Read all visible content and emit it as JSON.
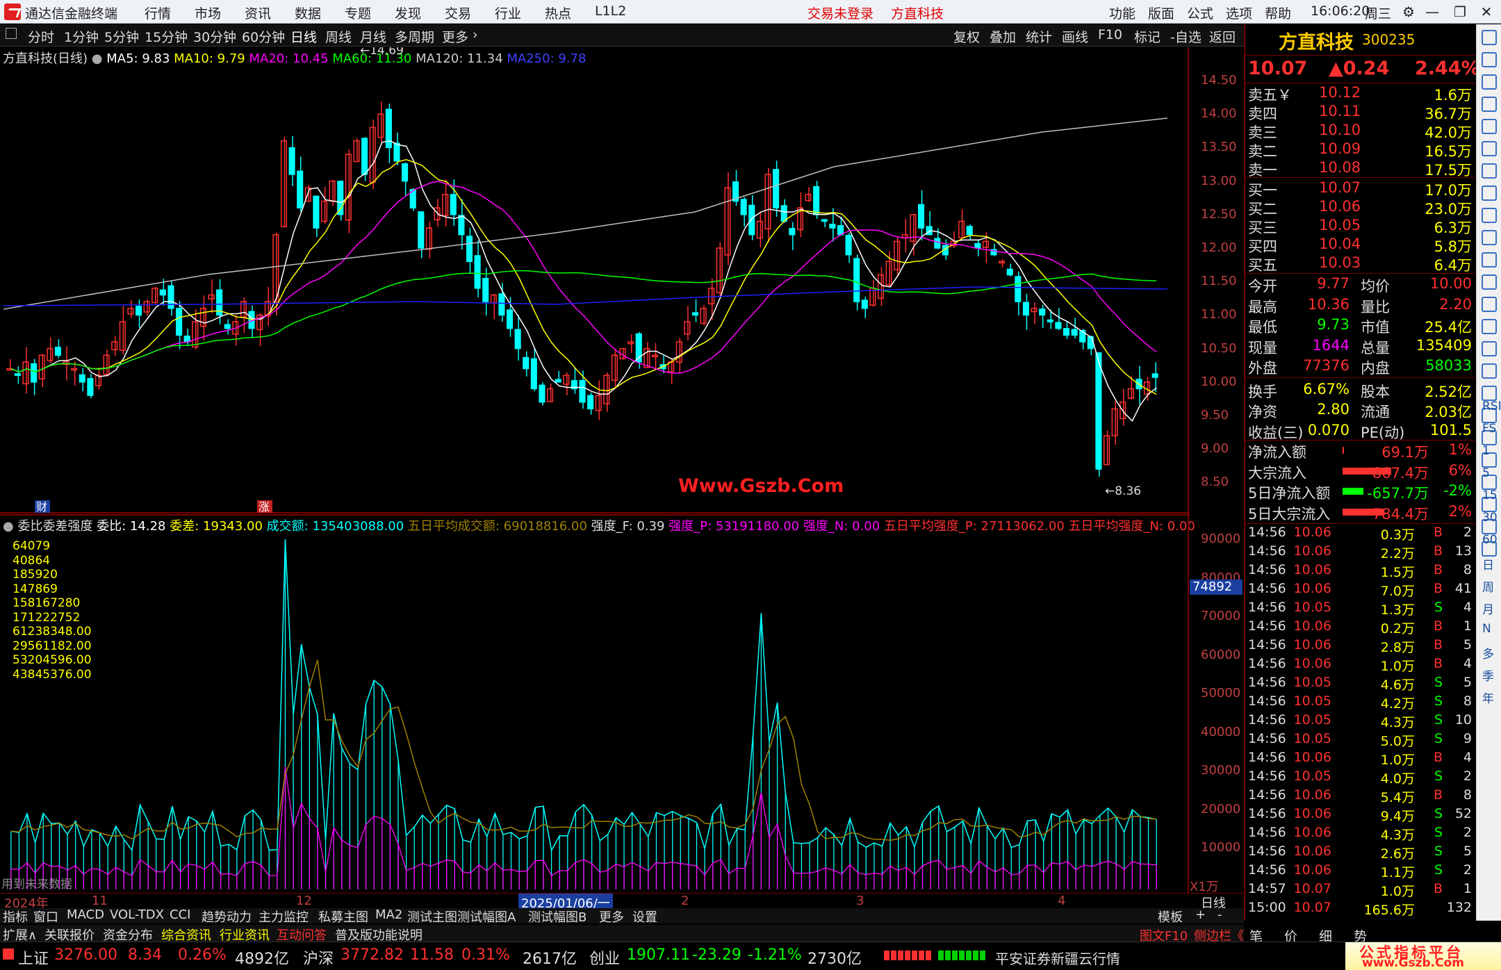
{
  "app": {
    "title": "通达信金融终端",
    "menu": [
      "行情",
      "市场",
      "资讯",
      "数据",
      "专题",
      "发现",
      "交易",
      "行业",
      "热点",
      "L1L2"
    ],
    "login": "交易未登录",
    "stock_title": "方直科技",
    "right_menu": [
      "功能",
      "版面",
      "公式",
      "选项",
      "帮助"
    ],
    "time": "16:06:20",
    "weekday": "周三"
  },
  "periods": [
    "分时",
    "1分钟",
    "5分钟",
    "15分钟",
    "30分钟",
    "60分钟",
    "日线",
    "周线",
    "月线",
    "多周期",
    "更多"
  ],
  "period_active": "日线",
  "chart_tools": [
    "复权",
    "叠加",
    "统计",
    "画线",
    "F10",
    "标记",
    "-自选",
    "返回"
  ],
  "ma_line": {
    "name": "方直科技(日线)",
    "ma5": "MA5: 9.83",
    "ma10": "MA10: 9.79",
    "ma20": "MA20: 10.45",
    "ma60": "MA60: 11.30",
    "ma120": "MA120: 11.34",
    "ma250": "MA250: 9.78"
  },
  "colors": {
    "up": "#ff3030",
    "down": "#00ffff",
    "ma5": "#ffffff",
    "ma10": "#ffff00",
    "ma20": "#ff00ff",
    "ma60": "#00ff00",
    "ma120": "#c0c0c0",
    "ma250": "#2020ff",
    "axis": "#c04040"
  },
  "price_axis": [
    "14.50",
    "14.00",
    "13.50",
    "13.00",
    "12.50",
    "12.00",
    "11.50",
    "11.00",
    "10.50",
    "10.00",
    "9.50",
    "9.00",
    "8.50"
  ],
  "price_high_label": "14.69",
  "price_low_label": "8.36",
  "watermark": "Www.Gszb.Com",
  "markers": {
    "cai": "财",
    "zhang": "涨"
  },
  "indicator": {
    "name": "委比委差强度",
    "wb": "委比: 14.28",
    "wc": "委差: 19343.00",
    "cje": "成交额: 135403088.00",
    "avg5": "五日平均成交额: 69018816.00",
    "qdf": "强度_F: 0.39",
    "qdp": "强度_P: 53191180.00",
    "qdn": "强度_N: 0.00",
    "avgp": "五日平均强度_P: 27113062.00",
    "avgn": "五日平均强度_N: 0.00"
  },
  "indicator_values": [
    "64079",
    "40864",
    "185920",
    "147869",
    "158167280",
    "171222752",
    "61238348.00",
    "29561182.00",
    "53204596.00",
    "43845376.00"
  ],
  "vol_axis": [
    "90000",
    "80000",
    "70000",
    "60000",
    "50000",
    "40000",
    "30000",
    "20000",
    "10000"
  ],
  "vol_marker": "74892",
  "vol_unit": "X1万",
  "vol_note": "用到未来数据",
  "date_axis": [
    "2024年",
    "11",
    "12",
    "2025/01/06/一",
    "2",
    "3",
    "4"
  ],
  "period_label": "日线",
  "bottom_tabs": [
    "指标",
    "窗口",
    "MACD",
    "VOL-TDX",
    "CCI",
    "趋势动力",
    "主力监控",
    "私募主图",
    "MA2",
    "测试主图",
    "测试幅图A",
    "测试幅图B",
    "更多",
    "设置"
  ],
  "bottom_right": [
    "模板",
    "+",
    "-"
  ],
  "bottom_tabs2": [
    "扩展∧",
    "关联报价",
    "资金分布",
    "综合资讯",
    "行业资讯",
    "互动问答",
    "普及版功能说明"
  ],
  "right_tabs": [
    "图文F10",
    "侧边栏《",
    "笔",
    "价",
    "细",
    "势"
  ],
  "quote": {
    "name": "方直科技",
    "code": "300235",
    "price": "10.07",
    "change": "▲0.24",
    "pct": "2.44%"
  },
  "orderbook": [
    {
      "label": "卖五￥",
      "price": "10.12",
      "vol": "1.6万"
    },
    {
      "label": "卖四",
      "price": "10.11",
      "vol": "36.7万"
    },
    {
      "label": "卖三",
      "price": "10.10",
      "vol": "42.0万"
    },
    {
      "label": "卖二",
      "price": "10.09",
      "vol": "16.5万"
    },
    {
      "label": "卖一",
      "price": "10.08",
      "vol": "17.5万"
    },
    {
      "label": "买一",
      "price": "10.07",
      "vol": "17.0万"
    },
    {
      "label": "买二",
      "price": "10.06",
      "vol": "23.0万"
    },
    {
      "label": "买三",
      "price": "10.05",
      "vol": "6.3万"
    },
    {
      "label": "买四",
      "price": "10.04",
      "vol": "5.8万"
    },
    {
      "label": "买五",
      "price": "10.03",
      "vol": "6.4万"
    }
  ],
  "stats": [
    [
      "今开",
      "9.77",
      "均价",
      "10.00"
    ],
    [
      "最高",
      "10.36",
      "量比",
      "2.20"
    ],
    [
      "最低",
      "9.73",
      "市值",
      "25.4亿"
    ],
    [
      "现量",
      "1644",
      "总量",
      "135409"
    ],
    [
      "外盘",
      "77376",
      "内盘",
      "58033"
    ],
    [
      "换手",
      "6.67%",
      "股本",
      "2.52亿"
    ],
    [
      "净资",
      "2.80",
      "流通",
      "2.03亿"
    ],
    [
      "收益(三)",
      "0.070",
      "PE(动)",
      "101.5"
    ]
  ],
  "flows": [
    {
      "label": "净流入额",
      "val": "69.1万",
      "pct": "1%"
    },
    {
      "label": "大宗流入",
      "val": "867.4万",
      "pct": "6%"
    },
    {
      "label": "5日净流入额",
      "val": "-657.7万",
      "pct": "-2%"
    },
    {
      "label": "5日大宗流入",
      "val": "784.4万",
      "pct": "2%"
    }
  ],
  "trades": [
    [
      "14:56",
      "10.06",
      "0.3万",
      "B",
      "2"
    ],
    [
      "14:56",
      "10.06",
      "2.2万",
      "B",
      "13"
    ],
    [
      "14:56",
      "10.06",
      "1.5万",
      "B",
      "8"
    ],
    [
      "14:56",
      "10.06",
      "7.0万",
      "B",
      "41"
    ],
    [
      "14:56",
      "10.05",
      "1.3万",
      "S",
      "4"
    ],
    [
      "14:56",
      "10.06",
      "0.2万",
      "B",
      "1"
    ],
    [
      "14:56",
      "10.06",
      "2.8万",
      "B",
      "5"
    ],
    [
      "14:56",
      "10.06",
      "1.0万",
      "B",
      "4"
    ],
    [
      "14:56",
      "10.05",
      "4.6万",
      "S",
      "5"
    ],
    [
      "14:56",
      "10.05",
      "4.2万",
      "S",
      "8"
    ],
    [
      "14:56",
      "10.05",
      "4.3万",
      "S",
      "10"
    ],
    [
      "14:56",
      "10.05",
      "5.0万",
      "S",
      "9"
    ],
    [
      "14:56",
      "10.06",
      "1.0万",
      "B",
      "4"
    ],
    [
      "14:56",
      "10.05",
      "4.0万",
      "S",
      "2"
    ],
    [
      "14:56",
      "10.06",
      "5.4万",
      "B",
      "8"
    ],
    [
      "14:56",
      "10.06",
      "9.4万",
      "S",
      "52"
    ],
    [
      "14:56",
      "10.06",
      "4.3万",
      "S",
      "2"
    ],
    [
      "14:56",
      "10.06",
      "2.6万",
      "S",
      "5"
    ],
    [
      "14:56",
      "10.06",
      "1.1万",
      "S",
      "2"
    ],
    [
      "14:57",
      "10.07",
      "1.0万",
      "B",
      "1"
    ],
    [
      "15:00",
      "10.07",
      "165.6万",
      "",
      "132"
    ]
  ],
  "sidebar_labels": [
    "RSI",
    "FS",
    "1",
    "5",
    "15",
    "30",
    "60",
    "日",
    "周",
    "月",
    "N",
    "多",
    "季",
    "年"
  ],
  "status": {
    "sh": "上证",
    "sh_v": "3276.00",
    "sh_c": "8.34",
    "sh_p": "0.26%",
    "sh_a": "4892亿",
    "sz": "沪深",
    "sz_v": "3772.82",
    "sz_c": "11.58",
    "sz_p": "0.31%",
    "sz_a": "2617亿",
    "cy": "创业",
    "cy_v": "1907.11",
    "cy_c": "-23.29",
    "cy_p": "-1.21%",
    "cy_a": "2730亿",
    "broker": "平安证券新疆云行情",
    "brand": "公式指标平台",
    "brand_url": "www.Gszb.Com"
  }
}
